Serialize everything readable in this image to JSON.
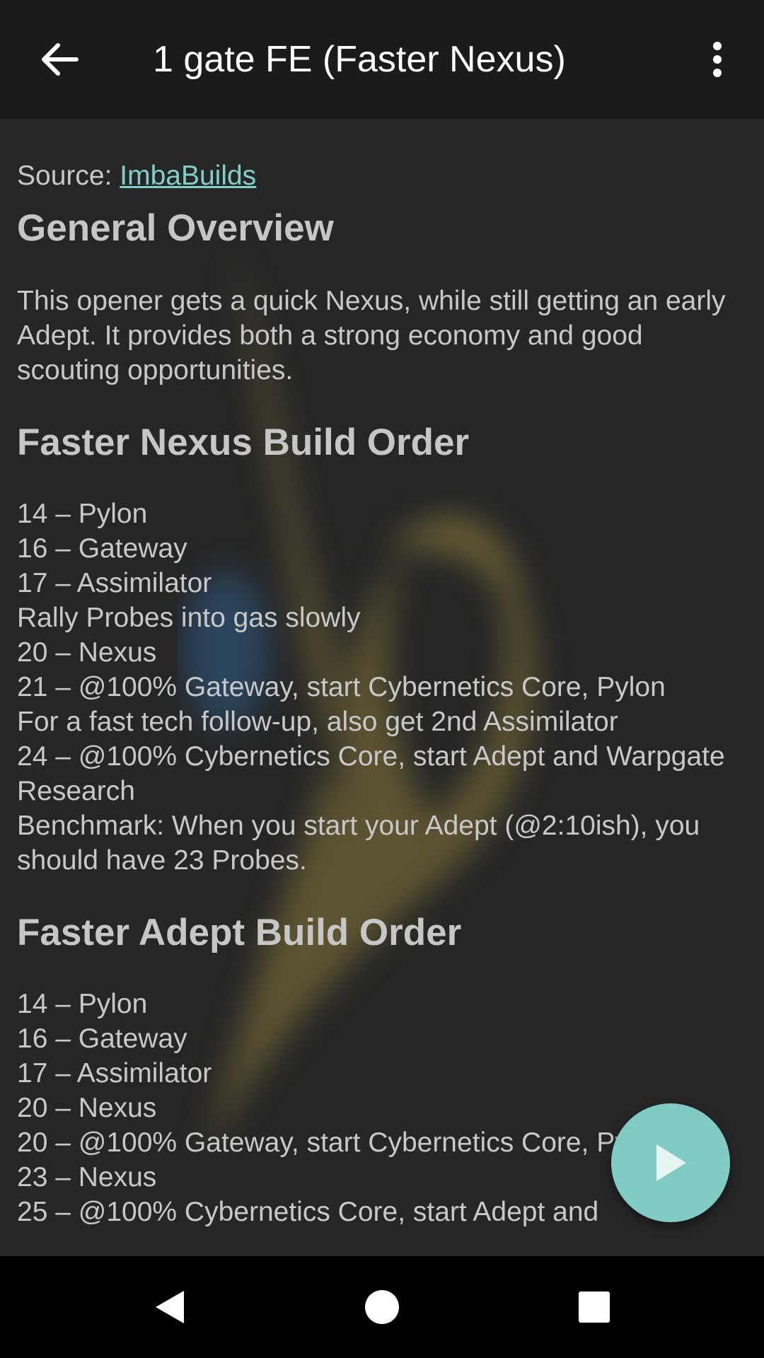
{
  "app_bar": {
    "title": "1 gate FE (Faster Nexus)",
    "back_icon": "arrow-left-icon",
    "menu_icon": "more-vert-icon"
  },
  "content": {
    "source_label": "Source: ",
    "source_link": "ImbaBuilds",
    "general_overview": {
      "heading": "General Overview",
      "text": "This opener gets a quick Nexus, while still getting an early Adept. It provides both a strong economy and good scouting opportunities."
    },
    "faster_nexus": {
      "heading": "Faster Nexus Build Order",
      "steps": [
        "14 – Pylon",
        "16 – Gateway",
        "17 – Assimilator",
        "Rally Probes into gas slowly",
        "20 – Nexus",
        "21 – @100% Gateway, start Cybernetics Core, Pylon",
        "For a fast tech follow-up, also get 2nd Assimilator",
        "24 – @100% Cybernetics Core, start Adept and Warpgate Research",
        "Benchmark: When you start your Adept (@2:10ish), you should have 23 Probes."
      ]
    },
    "faster_adept": {
      "heading": "Faster Adept Build Order",
      "steps": [
        "14 – Pylon",
        "16 – Gateway",
        "17 – Assimilator",
        "20 – Nexus",
        "20 – @100% Gateway, start Cybernetics Core, Pylon",
        "23 – Nexus",
        "25 – @100% Cybernetics Core, start Adept and"
      ]
    }
  },
  "fab": {
    "icon": "play-icon"
  },
  "nav_bar": {
    "back_icon": "nav-back-icon",
    "home_icon": "nav-home-icon",
    "recents_icon": "nav-recents-icon"
  },
  "colors": {
    "app_bar_bg": "#1b1b1b",
    "content_bg": "#262626",
    "link": "#7fd0c8",
    "fab": "#80cbc4",
    "text": "#c8c8c8"
  }
}
